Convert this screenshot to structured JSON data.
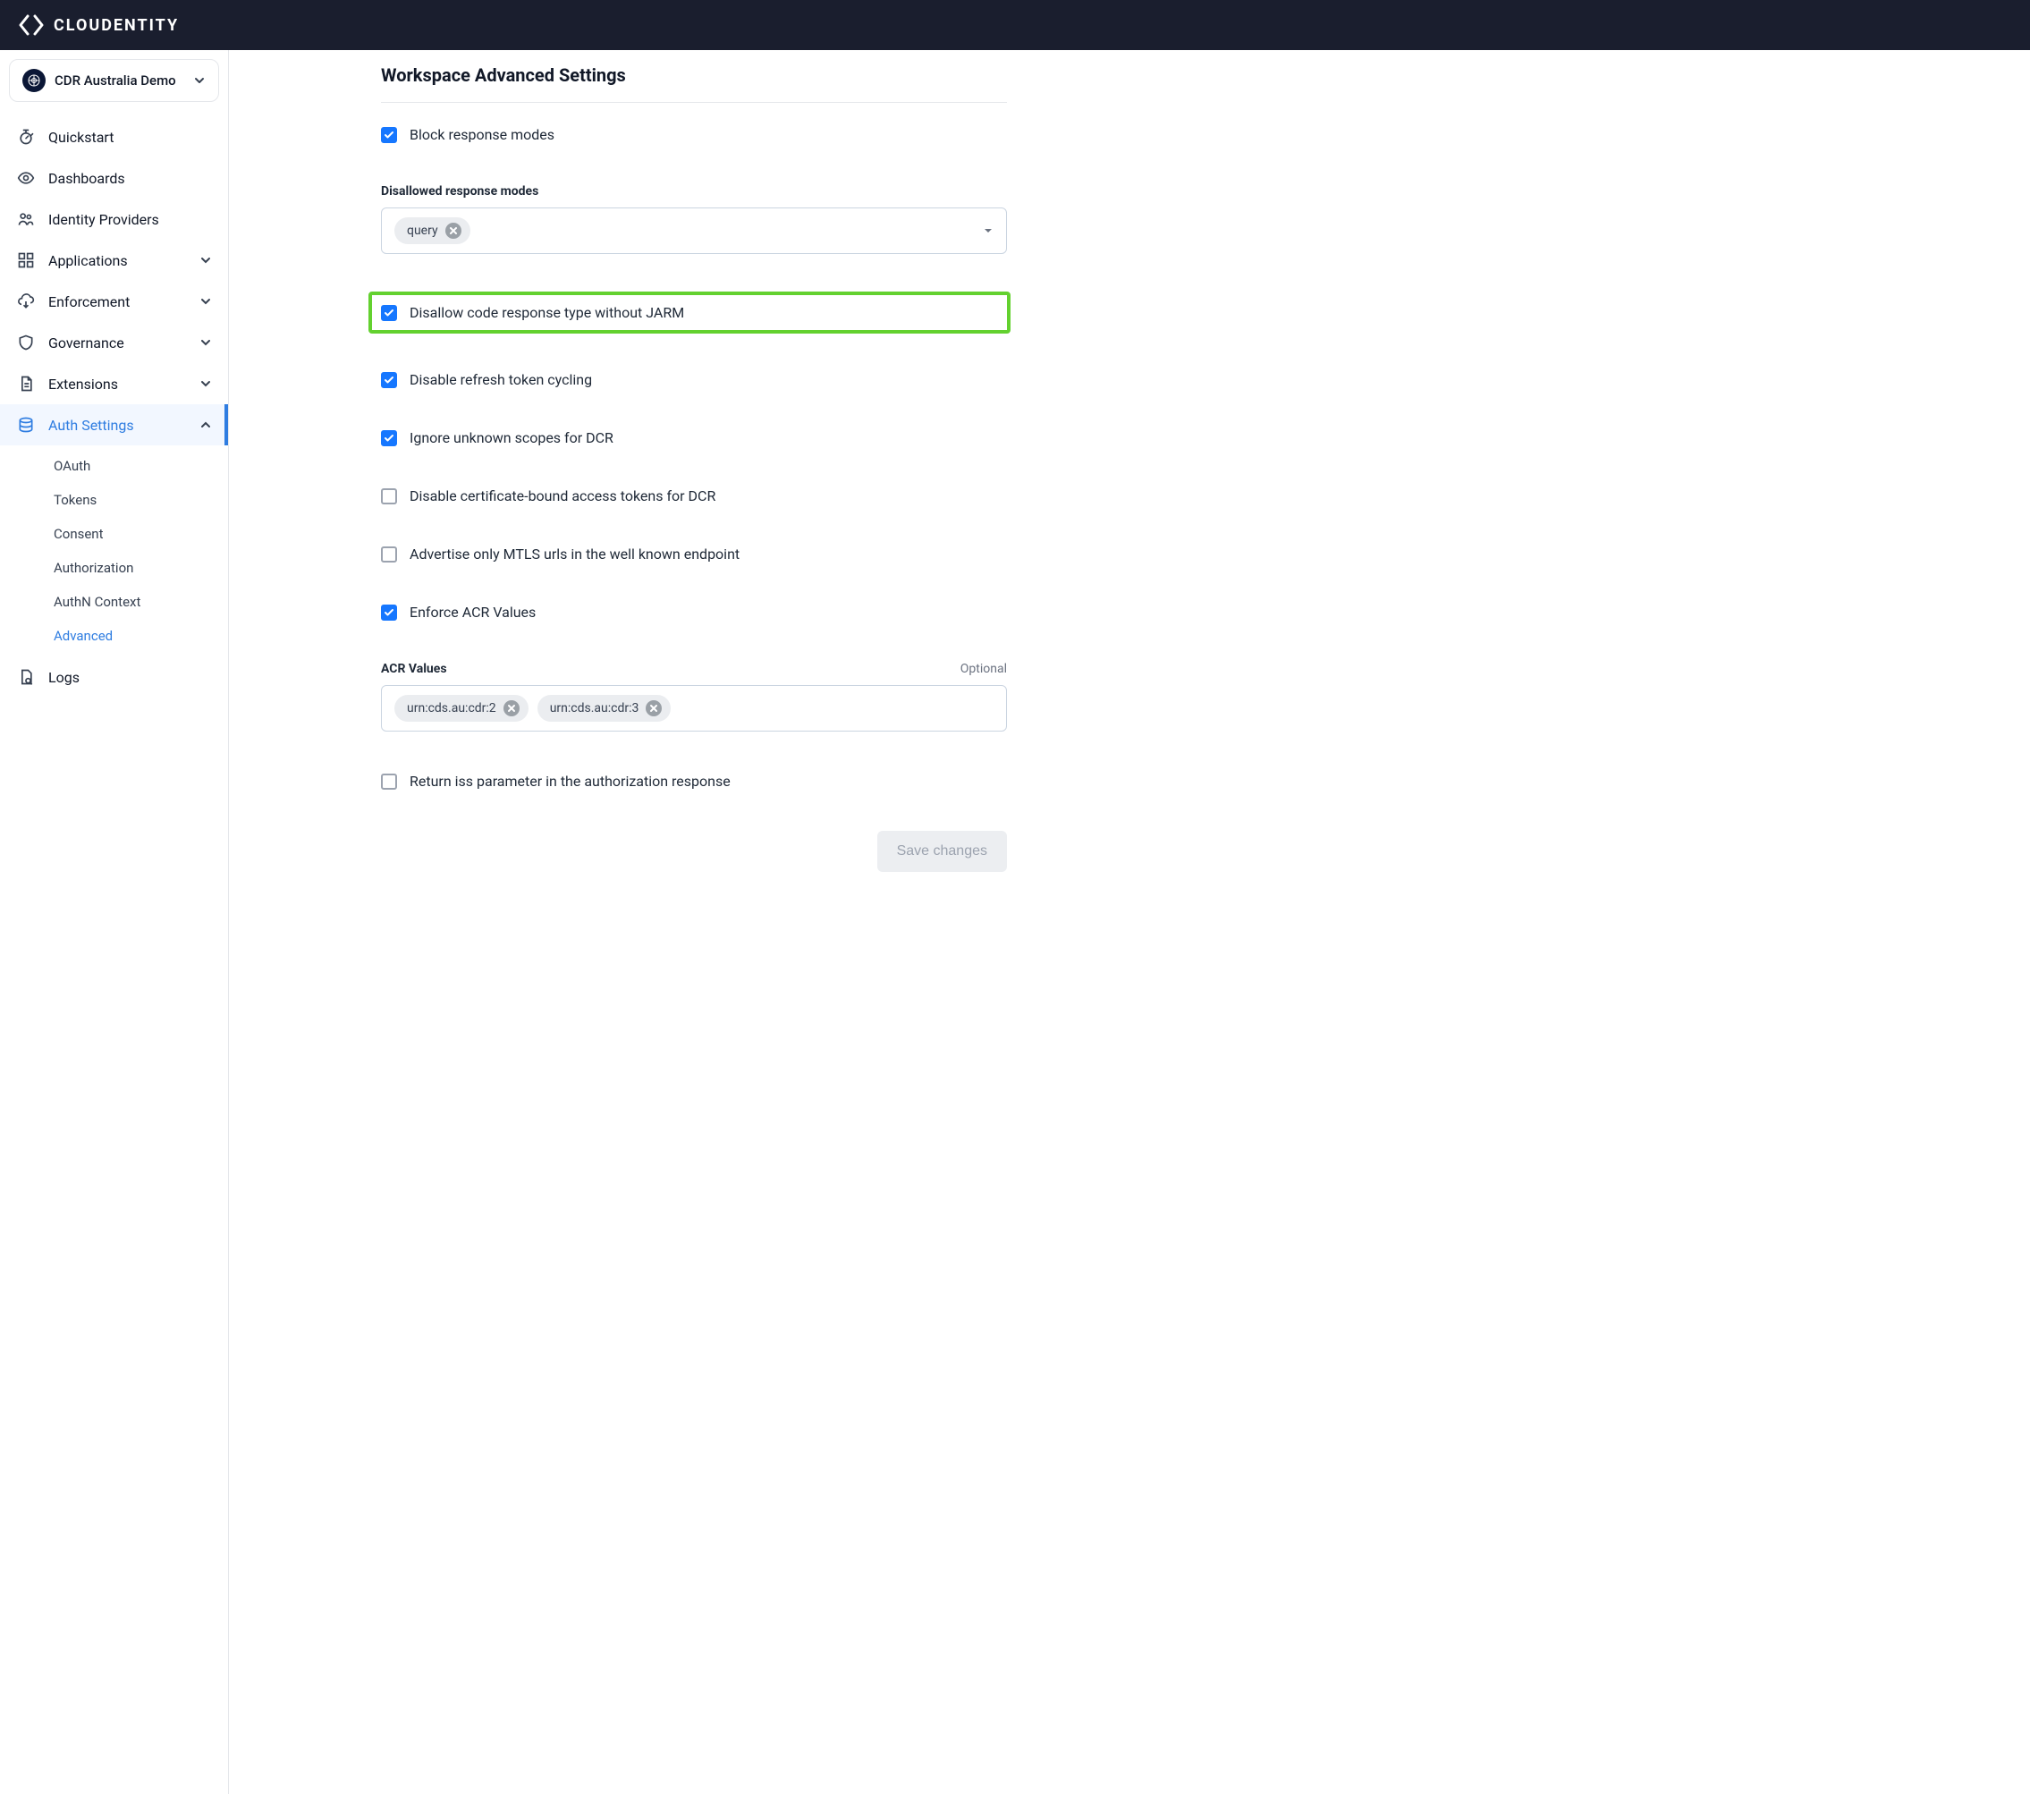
{
  "brand": {
    "name": "CLOUDENTITY"
  },
  "workspace": {
    "name": "CDR Australia Demo"
  },
  "sidebar": {
    "items": [
      {
        "label": "Quickstart",
        "icon": "stopwatch-icon",
        "expandable": false
      },
      {
        "label": "Dashboards",
        "icon": "eye-icon",
        "expandable": false
      },
      {
        "label": "Identity Providers",
        "icon": "users-icon",
        "expandable": false
      },
      {
        "label": "Applications",
        "icon": "grid-icon",
        "expandable": true
      },
      {
        "label": "Enforcement",
        "icon": "cloud-download-icon",
        "expandable": true
      },
      {
        "label": "Governance",
        "icon": "shield-icon",
        "expandable": true
      },
      {
        "label": "Extensions",
        "icon": "document-icon",
        "expandable": true
      },
      {
        "label": "Auth Settings",
        "icon": "database-icon",
        "expandable": true,
        "active": true
      },
      {
        "label": "Logs",
        "icon": "search-doc-icon",
        "expandable": false
      }
    ],
    "auth_sub": [
      {
        "label": "OAuth"
      },
      {
        "label": "Tokens"
      },
      {
        "label": "Consent"
      },
      {
        "label": "Authorization"
      },
      {
        "label": "AuthN Context"
      },
      {
        "label": "Advanced",
        "active": true
      }
    ]
  },
  "page": {
    "title": "Workspace Advanced Settings",
    "settings": {
      "block_response_modes": {
        "label": "Block response modes",
        "checked": true
      },
      "disallowed_response_modes": {
        "label": "Disallowed response modes",
        "chips": [
          "query"
        ]
      },
      "disallow_code_without_jarm": {
        "label": "Disallow code response type without JARM",
        "checked": true,
        "highlight": true
      },
      "disable_refresh_cycling": {
        "label": "Disable refresh token cycling",
        "checked": true
      },
      "ignore_unknown_scopes_dcr": {
        "label": "Ignore unknown scopes for DCR",
        "checked": true
      },
      "disable_cert_bound_dcr": {
        "label": "Disable certificate-bound access tokens for DCR",
        "checked": false
      },
      "advertise_mtls_only": {
        "label": "Advertise only MTLS urls in the well known endpoint",
        "checked": false
      },
      "enforce_acr": {
        "label": "Enforce ACR Values",
        "checked": true
      },
      "acr_values": {
        "label": "ACR Values",
        "optional": "Optional",
        "chips": [
          "urn:cds.au:cdr:2",
          "urn:cds.au:cdr:3"
        ]
      },
      "return_iss": {
        "label": "Return iss parameter in the authorization response",
        "checked": false
      }
    },
    "save_label": "Save changes"
  }
}
